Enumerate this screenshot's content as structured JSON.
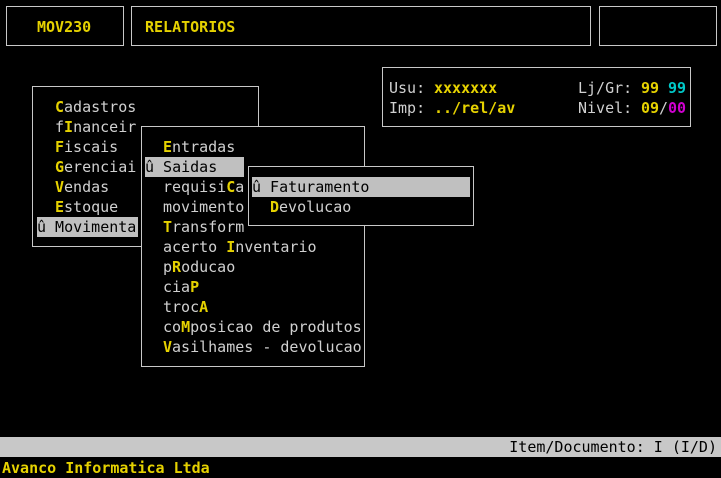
{
  "header": {
    "module_code": "MOV230",
    "screen_title": "RELATORIOS"
  },
  "info": {
    "user_label": "Usu:",
    "user_value": "xxxxxxx",
    "store_label": "Lj/Gr:",
    "store_value": "99",
    "group_value": "99",
    "printer_label": "Imp:",
    "printer_value": "../rel/av",
    "level_label": "Nivel:",
    "level_value": "09",
    "level_sep": "/",
    "level_sub": "00"
  },
  "main_menu": {
    "items": [
      {
        "pre": "",
        "hk": "C",
        "post": "adastros"
      },
      {
        "pre": "f",
        "hk": "I",
        "post": "nanceir"
      },
      {
        "pre": "",
        "hk": "F",
        "post": "iscais"
      },
      {
        "pre": "",
        "hk": "G",
        "post": "erenciai"
      },
      {
        "pre": "",
        "hk": "V",
        "post": "endas"
      },
      {
        "pre": "",
        "hk": "E",
        "post": "stoque"
      },
      {
        "pre": "û Movimenta",
        "hk": "",
        "post": ""
      }
    ]
  },
  "mov_menu": {
    "items": [
      {
        "pre": "",
        "hk": "E",
        "post": "ntradas"
      },
      {
        "pre": "û Saidas",
        "hk": "",
        "post": ""
      },
      {
        "pre": "requisi",
        "hk": "C",
        "post": "a"
      },
      {
        "pre": "movimento",
        "hk": "",
        "post": ""
      },
      {
        "pre": "",
        "hk": "T",
        "post": "ransform"
      },
      {
        "pre": "acerto ",
        "hk": "I",
        "post": "nventario"
      },
      {
        "pre": "p",
        "hk": "R",
        "post": "oducao"
      },
      {
        "pre": "cia",
        "hk": "P",
        "post": ""
      },
      {
        "pre": "troc",
        "hk": "A",
        "post": ""
      },
      {
        "pre": "co",
        "hk": "M",
        "post": "posicao de produtos"
      },
      {
        "pre": "",
        "hk": "V",
        "post": "asilhames - devolucao"
      }
    ]
  },
  "saidas_menu": {
    "items": [
      {
        "pre": "û Faturamento",
        "hk": "",
        "post": ""
      },
      {
        "pre": "",
        "hk": "D",
        "post": "evolucao"
      }
    ]
  },
  "status": {
    "prompt": "Item/Documento: I (I/D)"
  },
  "footer": {
    "company": "Avanco Informatica Ltda"
  }
}
